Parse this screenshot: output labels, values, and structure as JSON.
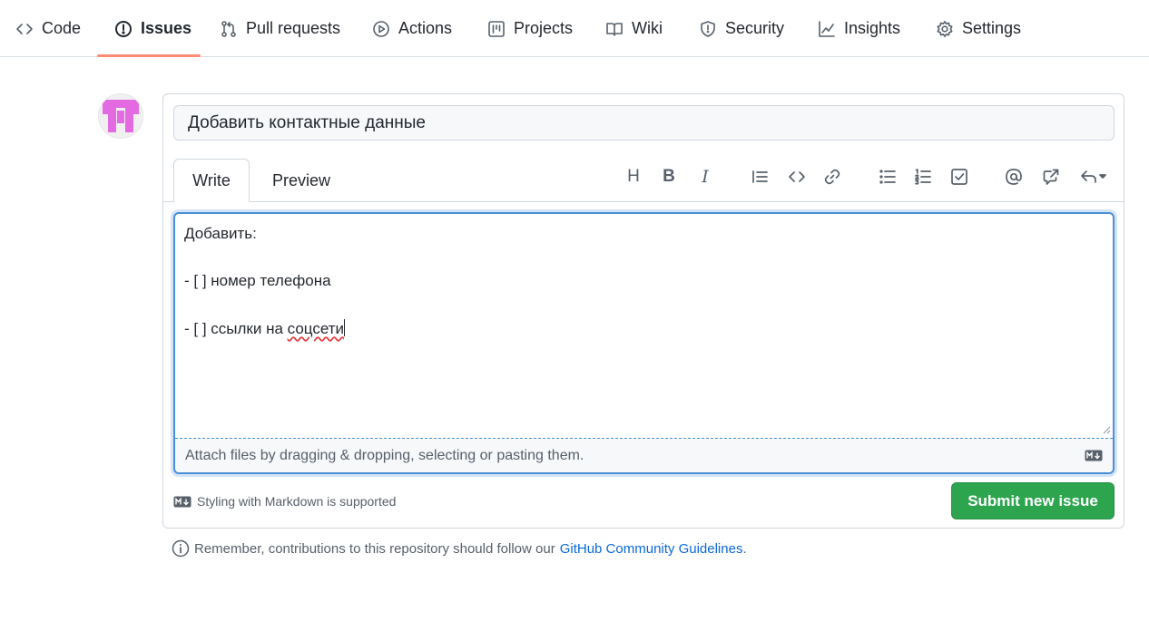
{
  "nav": {
    "items": [
      {
        "label": "Code",
        "icon": "code-icon"
      },
      {
        "label": "Issues",
        "icon": "issue-opened-icon",
        "selected": true
      },
      {
        "label": "Pull requests",
        "icon": "git-pull-request-icon"
      },
      {
        "label": "Actions",
        "icon": "play-icon"
      },
      {
        "label": "Projects",
        "icon": "project-icon"
      },
      {
        "label": "Wiki",
        "icon": "book-icon"
      },
      {
        "label": "Security",
        "icon": "shield-icon"
      },
      {
        "label": "Insights",
        "icon": "graph-icon"
      },
      {
        "label": "Settings",
        "icon": "gear-icon"
      }
    ],
    "selected_indicator_color": "#fd8c73"
  },
  "issue": {
    "title_value": "Добавить контактные данные",
    "tabs": {
      "write": "Write",
      "preview": "Preview"
    },
    "toolbar": {
      "heading": "H",
      "bold": "B",
      "italic": "I",
      "tools": [
        "heading-icon",
        "bold-icon",
        "italic-icon",
        "quote-icon",
        "code-icon",
        "link-icon",
        "unordered-list-icon",
        "ordered-list-icon",
        "tasklist-icon",
        "mention-icon",
        "cross-reference-icon",
        "reply-icon"
      ]
    },
    "body": {
      "line1": "Добавить:",
      "line2": "- [ ] номер телефона",
      "line3_prefix": "- [ ] ссылки на ",
      "line3_misspelled": "соцсети"
    },
    "attach_hint": "Attach files by dragging & dropping, selecting or pasting them.",
    "markdown_hint": "Styling with Markdown is supported",
    "submit_label": "Submit new issue"
  },
  "footer": {
    "text": "Remember, contributions to this repository should follow our",
    "link": "GitHub Community Guidelines",
    "suffix": "."
  },
  "colors": {
    "submit_green": "#2da44e",
    "focus_blue": "#4a8fd6",
    "link_blue": "#0969da",
    "avatar_pink": "#e36ae0"
  }
}
